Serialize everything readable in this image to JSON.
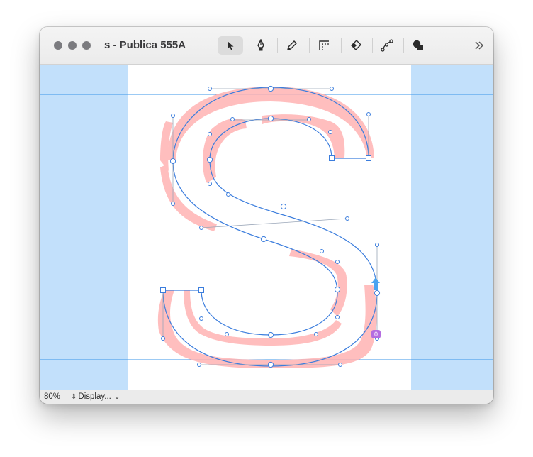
{
  "window": {
    "title": "s - Publica 555A",
    "traffic_lights": [
      "close",
      "minimize",
      "zoom"
    ]
  },
  "toolbar": {
    "tools": [
      {
        "name": "select-tool",
        "icon": "pointer-icon",
        "active": true
      },
      {
        "name": "pen-tool",
        "icon": "pen-nib-icon",
        "active": false
      },
      {
        "name": "pencil-tool",
        "icon": "pencil-icon",
        "active": false
      },
      {
        "name": "corner-tool",
        "icon": "corner-icon",
        "active": false
      },
      {
        "name": "eraser-tool",
        "icon": "eraser-icon",
        "active": false
      },
      {
        "name": "node-tool",
        "icon": "node-icon",
        "active": false
      },
      {
        "name": "shapes-tool",
        "icon": "shapes-icon",
        "active": false
      }
    ],
    "overflow_icon": "chevron-double-right-icon"
  },
  "canvas": {
    "colors": {
      "margin": "#c2e0fb",
      "glyph_area": "#ffffff",
      "outline": "#3b7ddd",
      "curvature": "#ff8a8a",
      "metric_line": "#3a96e8"
    },
    "point_badge": "0"
  },
  "statusbar": {
    "zoom": "80%",
    "display_label": "Display..."
  }
}
